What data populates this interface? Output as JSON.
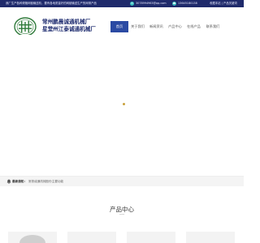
{
  "topbar": {
    "promo": "我厂生产各种规格网链输送机，要有各地质量好的网链输送生产的网带产品",
    "email": "3078994963@qq.com",
    "phone": "13645180138",
    "login": "收藏本站 | 产品关键词"
  },
  "brand": {
    "line1": "常州鹏晨诚通机械厂",
    "line2": "星堂州江泰诚通机械厂"
  },
  "nav": {
    "items": [
      "首页",
      "关于我们",
      "新闻资讯",
      "产品中心",
      "在线产品",
      "联系我们"
    ]
  },
  "notice": {
    "label": "最新通知：",
    "message": "常熟诚通机械股份主要功能"
  },
  "section": {
    "title": "产品中心"
  },
  "colors": {
    "topbar_bg": "#1f2a6b",
    "nav_active_bg": "#2b4aa3",
    "brand_text": "#1c2a6e",
    "icon_accent": "#39c0c2",
    "loader": "#c9a13c"
  }
}
